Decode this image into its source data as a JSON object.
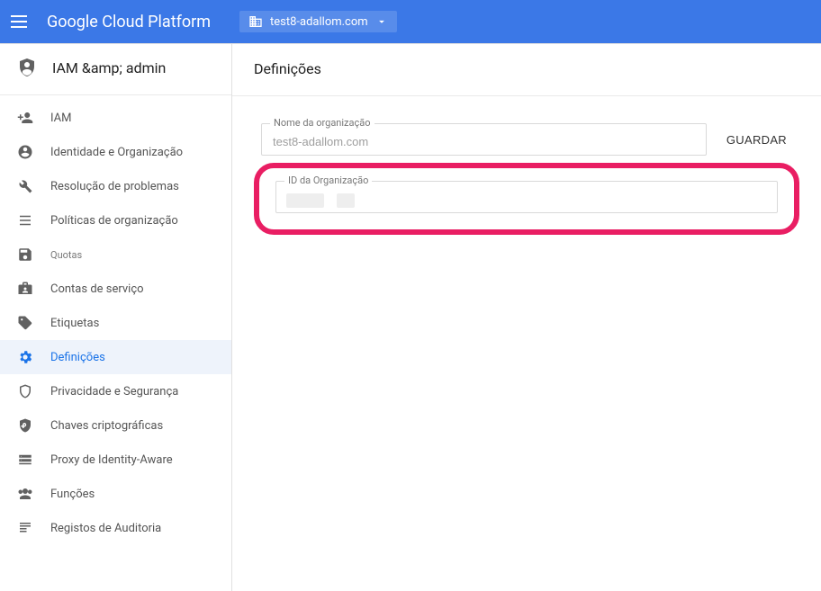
{
  "header": {
    "brand": "Google Cloud Platform",
    "project": "test8-adallom.com"
  },
  "sidebar": {
    "title": "IAM &amp; admin",
    "items": [
      {
        "label": "IAM",
        "icon": "person-add"
      },
      {
        "label": "Identidade e Organização",
        "icon": "person-circle"
      },
      {
        "label": "Resolução de problemas",
        "icon": "wrench"
      },
      {
        "label": "Políticas de organização",
        "icon": "list"
      },
      {
        "label": "Quotas",
        "icon": "save",
        "small": true
      },
      {
        "label": "Contas de serviço",
        "icon": "badge"
      },
      {
        "label": "Etiquetas",
        "icon": "tag"
      },
      {
        "label": "Definições",
        "icon": "gear",
        "active": true
      },
      {
        "label": "Privacidade e Segurança",
        "icon": "shield-outline"
      },
      {
        "label": "Chaves criptográficas",
        "icon": "key-shield"
      },
      {
        "label": "Proxy de Identity-Aware",
        "icon": "proxy"
      },
      {
        "label": "Funções",
        "icon": "roles"
      },
      {
        "label": "Registos de Auditoria",
        "icon": "audit"
      }
    ]
  },
  "main": {
    "title": "Definições",
    "org_name_label": "Nome da organização",
    "org_name_value": "test8-adallom.com",
    "save_label": "GUARDAR",
    "org_id_label": "ID da Organização",
    "org_id_value": ""
  }
}
